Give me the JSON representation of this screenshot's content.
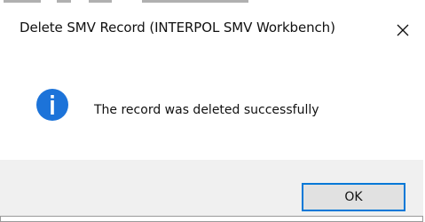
{
  "dialog": {
    "title": "Delete SMV Record (INTERPOL SMV Workbench)",
    "close_icon": "close-icon",
    "message_icon": "info-icon",
    "message": "The record was deleted successfully",
    "ok_label": "OK",
    "colors": {
      "accent": "#0078d7",
      "info_icon_fill": "#1c73d9",
      "footer_bg": "#f0f0f0",
      "button_bg": "#e1e1e1"
    }
  }
}
